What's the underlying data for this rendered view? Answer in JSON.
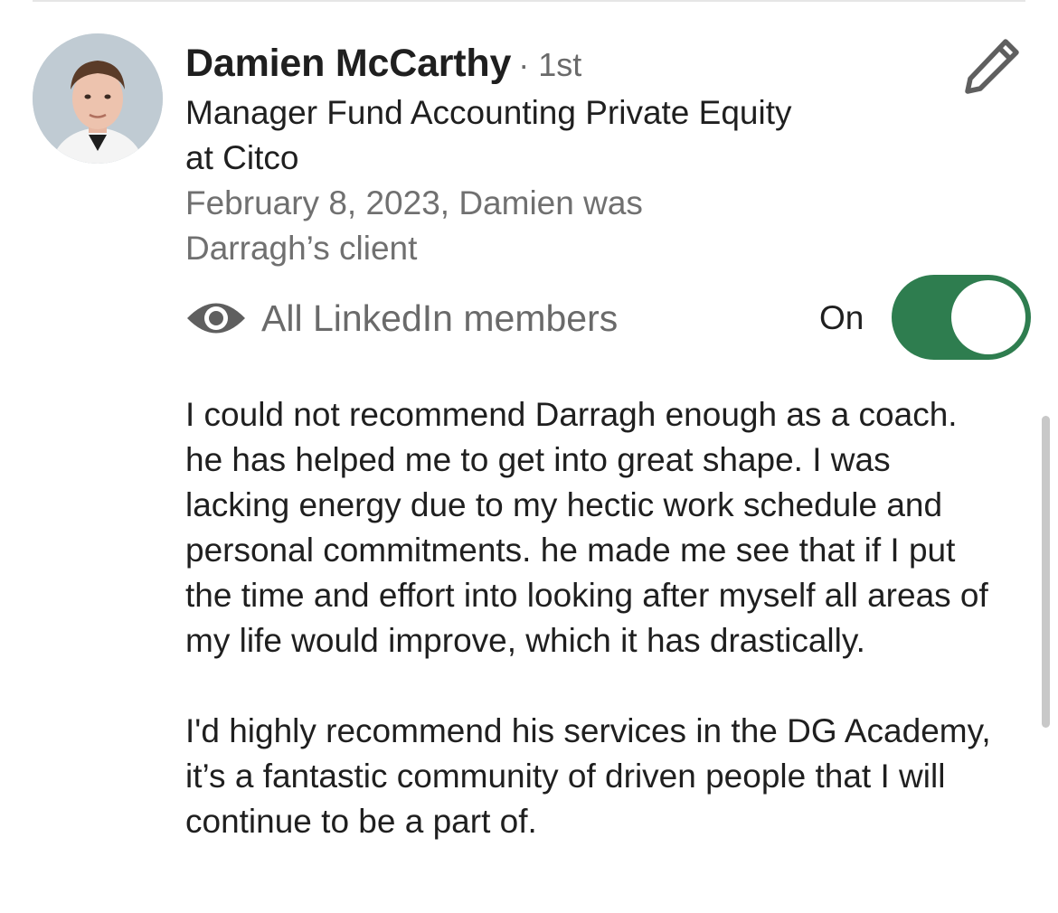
{
  "recommendation": {
    "author": {
      "name": "Damien McCarthy",
      "connection_degree": "· 1st",
      "headline": "Manager Fund Accounting Private Equity at Citco",
      "relation": "February 8, 2023, Damien was Darragh’s client"
    },
    "visibility": {
      "icon": "eye-icon",
      "label": "All LinkedIn members",
      "toggle_label": "On",
      "toggle_state": true,
      "toggle_color": "#2e7d4f"
    },
    "text_paragraphs": [
      "I could not recommend Darragh enough as a coach. he has helped me to get into great shape. I was lacking energy due to my hectic work schedule and personal commitments. he made me see that if I put the time and effort into looking after myself all areas of my life would improve, which it has drastically.",
      "I'd highly recommend his services in the DG Academy, it’s a fantastic community of driven people that I will continue to be a part of."
    ],
    "edit_icon": "pencil-icon"
  }
}
